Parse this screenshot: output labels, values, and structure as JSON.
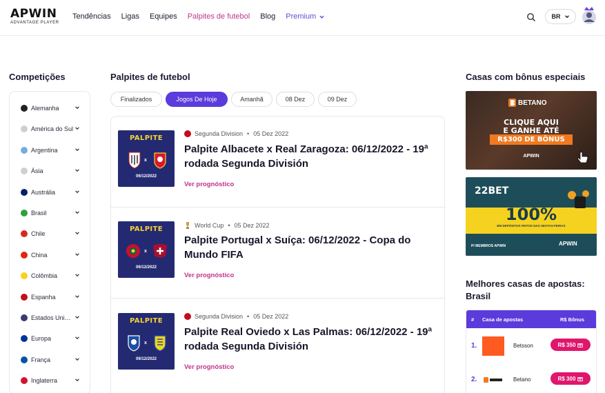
{
  "header": {
    "logo": "APWIN",
    "logo_sub": "ADVANTAGE PLAYER",
    "nav": [
      {
        "label": "Tendências"
      },
      {
        "label": "Ligas"
      },
      {
        "label": "Equipes"
      },
      {
        "label": "Palpites de futebol",
        "active": true
      },
      {
        "label": "Blog"
      },
      {
        "label": "Premium"
      }
    ],
    "lang": "BR",
    "icons": {
      "search": "search-icon",
      "lang_chevron": "chevron-down-icon",
      "avatar": "user-avatar-icon"
    }
  },
  "sidebar": {
    "title": "Competições",
    "items": [
      {
        "label": "Alemanha",
        "flag": "#222222"
      },
      {
        "label": "América do Sul",
        "flag": "#cfcfcf"
      },
      {
        "label": "Argentina",
        "flag": "#74acdf"
      },
      {
        "label": "Ásia",
        "flag": "#cfcfcf"
      },
      {
        "label": "Austrália",
        "flag": "#012169"
      },
      {
        "label": "Brasil",
        "flag": "#2aa43a"
      },
      {
        "label": "Chile",
        "flag": "#d52b1e"
      },
      {
        "label": "China",
        "flag": "#de2910"
      },
      {
        "label": "Colômbia",
        "flag": "#fcd116"
      },
      {
        "label": "Espanha",
        "flag": "#c60b1e"
      },
      {
        "label": "Estados Unidos",
        "flag": "#3c3b6e"
      },
      {
        "label": "Europa",
        "flag": "#003399"
      },
      {
        "label": "França",
        "flag": "#0055a4"
      },
      {
        "label": "Inglaterra",
        "flag": "#cf142b"
      }
    ]
  },
  "main": {
    "title": "Palpites de futebol",
    "tabs": [
      {
        "label": "Finalizados"
      },
      {
        "label": "Jogos De Hoje",
        "active": true
      },
      {
        "label": "Amanhã"
      },
      {
        "label": "08 Dez"
      },
      {
        "label": "09 Dez"
      }
    ],
    "cards": [
      {
        "league": "Segunda Division",
        "date": "05 Dez 2022",
        "title": "Palpite Albacete x Real Zaragoza: 06/12/2022 - 19ª rodada Segunda División",
        "link": "Ver prognóstico",
        "thumb_title": "PALPITE",
        "thumb_date": "06/12/2022",
        "league_flag": "#c60b1e",
        "team_a_color": "#ffffff",
        "team_b_color": "#d9182a"
      },
      {
        "league": "World Cup",
        "date": "05 Dez 2022",
        "title": "Palpite Portugal x Suíça: 06/12/2022 - Copa do Mundo FIFA",
        "link": "Ver prognóstico",
        "thumb_title": "PALPITE",
        "thumb_date": "06/12/2022",
        "league_flag": "#b8963a",
        "team_a_color": "#c8102e",
        "team_b_color": "#a8102e"
      },
      {
        "league": "Segunda Division",
        "date": "05 Dez 2022",
        "title": "Palpite Real Oviedo x Las Palmas: 06/12/2022 - 19ª rodada Segunda División",
        "link": "Ver prognóstico",
        "thumb_title": "PALPITE",
        "thumb_date": "06/12/2022",
        "league_flag": "#c60b1e",
        "team_a_color": "#1d4fa3",
        "team_b_color": "#f5d21f"
      }
    ]
  },
  "right": {
    "bonus_title": "Casas com bônus especiais",
    "banner1": {
      "brand": "BETANO",
      "line1": "CLIQUE AQUI",
      "line2": "E GANHE ATÉ",
      "bonus": "R$300 DE BÔNUS",
      "apwin": "APWIN"
    },
    "banner2": {
      "brand": "22BET",
      "big": "100%",
      "sub": "EM DEPÓSITOS FEITOS NAS SEXTAS-FEIRAS",
      "members": "P/ MEMBROS APWIN",
      "apwin": "APWIN"
    },
    "ranking_title": "Melhores casas de apostas: Brasil",
    "ranking_head": {
      "num": "#",
      "house": "Casa de apostas",
      "bonus": "R$ Bônus"
    },
    "ranking": [
      {
        "num": "1.",
        "name": "Betsson",
        "bonus": "R$ 350",
        "logo_color": "#ff5a1f"
      },
      {
        "num": "2.",
        "name": "Betano",
        "bonus": "R$ 300",
        "logo_color": "#ffffff"
      }
    ]
  }
}
